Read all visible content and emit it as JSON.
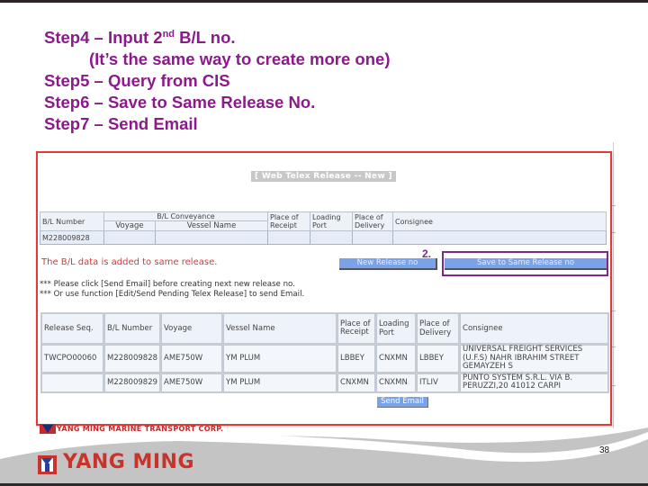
{
  "slide": {
    "steps": [
      {
        "prefix": "Step4 – Input 2",
        "sup": "nd",
        "suffix": " B/L no."
      },
      {
        "text": "(It’s the same way to create more one)"
      },
      {
        "text": "Step5 – Query from CIS"
      },
      {
        "text": "Step6 – Save to Same Release No."
      },
      {
        "text": "Step7 – Send Email"
      }
    ],
    "page_number": "38",
    "callout_number": "2.",
    "footer_logo": "YANG MING",
    "colors": {
      "step_text": "#8b1a8b",
      "frame_border": "#e03a3a",
      "brand_red": "#c8342c",
      "highlight": "#7c2a86"
    }
  },
  "app": {
    "title": "[ Web Telex Release -- New ]",
    "entry_table": {
      "headers": {
        "bl_number": "B/L Number",
        "conveyance": "B/L Conveyance",
        "voyage": "Voyage",
        "vessel_name": "Vessel Name",
        "place_of_receipt": "Place of Receipt",
        "loading_port": "Loading Port",
        "place_of_delivery": "Place of Delivery",
        "consignee": "Consignee"
      },
      "values": {
        "bl_number": "M228009828",
        "voyage": "",
        "vessel_name": "",
        "place_of_receipt": "",
        "loading_port": "",
        "place_of_delivery": "",
        "consignee": ""
      }
    },
    "status_message": "The B/L data is added to same release.",
    "notes": [
      "*** Please click [Send Email] before creating next new release no.",
      "*** Or use function [Edit/Send Pending Telex Release] to send Email."
    ],
    "buttons": {
      "new_release": "New Release no",
      "save_same_release": "Save to Same Release no",
      "send_email": "Send Email"
    },
    "result_table": {
      "headers": [
        "Release Seq.",
        "B/L Number",
        "Voyage",
        "Vessel Name",
        "Place of Receipt",
        "Loading Port",
        "Place of Delivery",
        "Consignee"
      ],
      "rows": [
        [
          "TWCPO00060",
          "M228009828",
          "AME750W",
          "YM PLUM",
          "LBBEY",
          "CNXMN",
          "LBBEY",
          "UNIVERSAL FREIGHT SERVICES (U.F.S) NAHR IBRAHIM STREET GEMAYZEH S"
        ],
        [
          "",
          "M228009829",
          "AME750W",
          "YM PLUM",
          "CNXMN",
          "CNXMN",
          "ITLIV",
          "PUNTO SYSTEM S.R.L. VIA B. PERUZZI,20 41012 CARPI"
        ]
      ]
    },
    "corp_name": "YANG MING MARINE TRANSPORT CORP."
  }
}
